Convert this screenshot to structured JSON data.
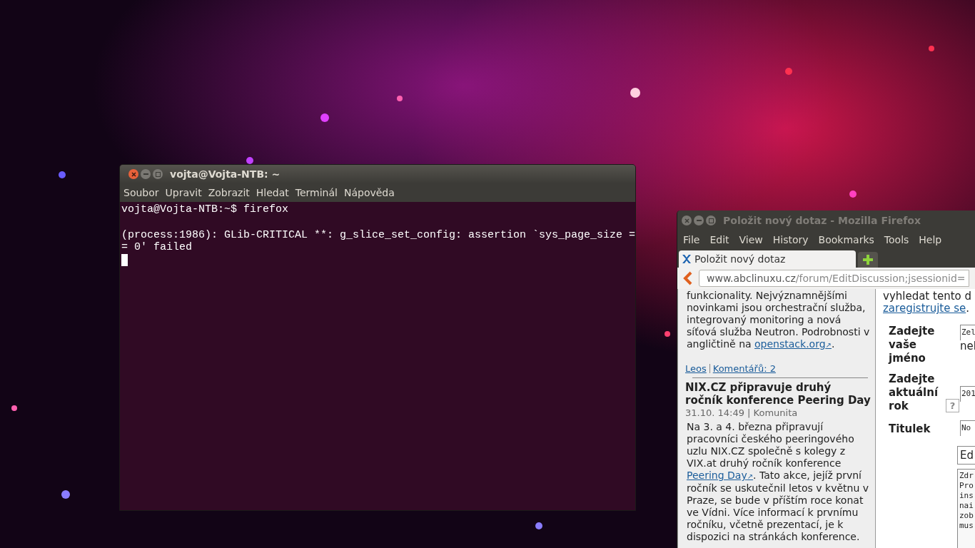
{
  "terminal": {
    "title": "vojta@Vojta-NTB: ~",
    "menu": [
      "Soubor",
      "Upravit",
      "Zobrazit",
      "Hledat",
      "Terminál",
      "Nápověda"
    ],
    "prompt": "vojta@Vojta-NTB:~$ firefox",
    "output": [
      "(process:1986): GLib-CRITICAL **: g_slice_set_config: assertion `sys_page_size =",
      "= 0' failed"
    ]
  },
  "browser": {
    "title": "Položit nový dotaz - Mozilla Firefox",
    "menu": [
      "File",
      "Edit",
      "View",
      "History",
      "Bookmarks",
      "Tools",
      "Help"
    ],
    "tabs": [
      {
        "label": "Položit nový dotaz",
        "selected": true
      }
    ],
    "url": {
      "domain": "www.abclinuxu.cz",
      "path": "/forum/EditDiscussion;jsessionid="
    },
    "sidebar": {
      "intro": {
        "text": "funkcionality. Nejvýznamnějšími novinkami jsou orchestrační služba, integrovaný monitoring a nová síťová služba Neutron. Podrobnosti v angličtině na ",
        "link": "openstack.org",
        "link_mark": "↗",
        "tail": "."
      },
      "meta_links": [
        "Leos",
        "Komentářů: 2"
      ],
      "article": {
        "title": "NIX.CZ připravuje druhý ročník konference Peering Day",
        "meta": "31.10. 14:49 | Komunita",
        "text": "Na 3. a 4. března připravují pracovníci českého peeringového uzlu NIX.CZ společně s kolegy z VIX.at druhý ročník konference ",
        "link": "Peering Day",
        "link_mark": "↗",
        "tail": ". Tato akce, jejíž první ročník se uskutečnil letos v květnu v Praze, se bude v příštím roce konat ve Vídni. Více informací k prvnímu ročníku, včetně prezentací, je k dispozici na stránkách konference."
      }
    },
    "form": {
      "intro": "vyhledat tento d",
      "register_link": "zaregistrujte se",
      "register_tail": ".",
      "fields": [
        {
          "label": "Zadejte vaše jméno",
          "value": "Zel",
          "note": "nel"
        },
        {
          "label": "Zadejte aktuální rok",
          "help": "?",
          "value": "201"
        },
        {
          "label": "Titulek",
          "value": "No"
        }
      ],
      "editor_button": "Ed",
      "textarea": [
        "Zdr",
        "Pro",
        "ins",
        "nai",
        "zob",
        "mus"
      ]
    }
  }
}
